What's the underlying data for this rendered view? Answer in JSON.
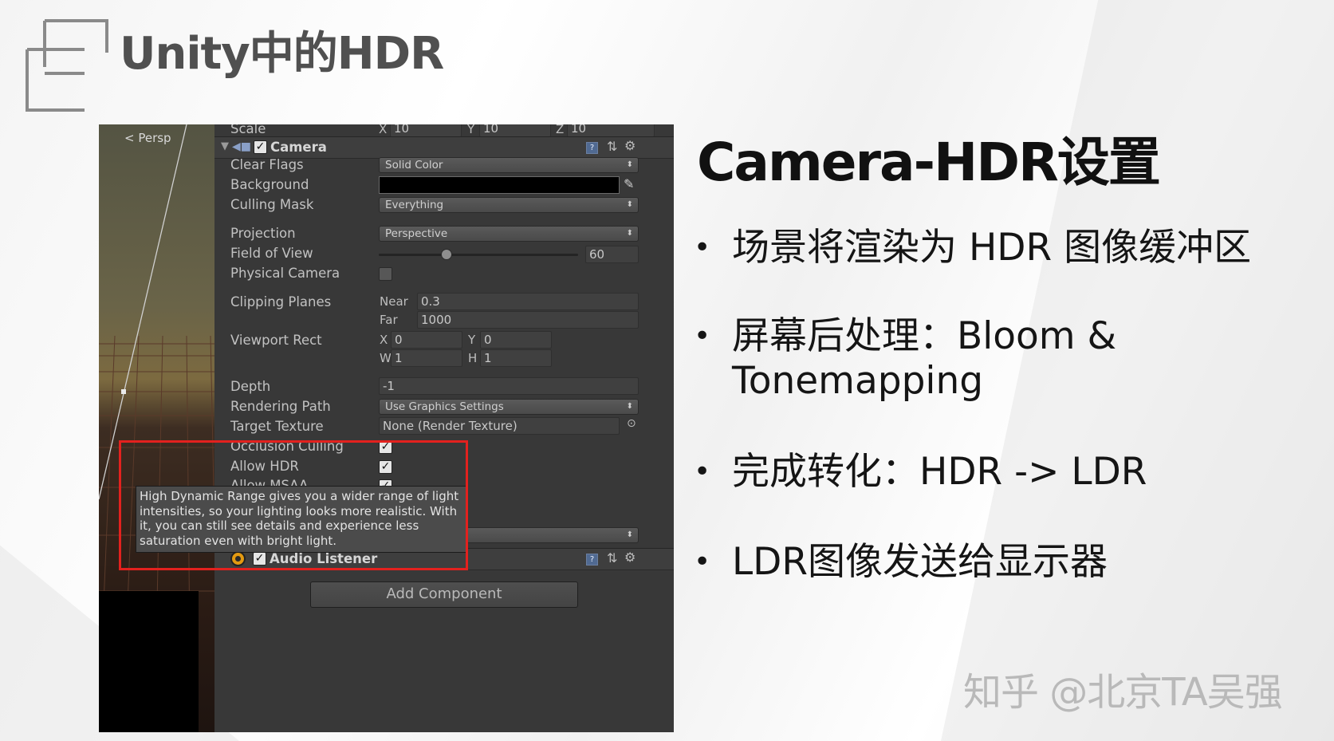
{
  "slide": {
    "title": "Unity中的HDR",
    "subtitle": "Camera-HDR设置",
    "bullets": [
      "场景将渲染为 HDR 图像缓冲区",
      "屏幕后处理：Bloom & Tonemapping",
      "完成转化：HDR -> LDR",
      "LDR图像发送给显示器"
    ],
    "bullet_symbol": "•",
    "watermark": "知乎 @北京TA吴强"
  },
  "scene_view": {
    "persp_label": "< Persp"
  },
  "inspector": {
    "scale_row": {
      "label": "Scale",
      "x_label": "X",
      "x": "10",
      "y_label": "Y",
      "y": "10",
      "z_label": "Z",
      "z": "10"
    },
    "camera_component": {
      "title": "Camera",
      "enabled": true,
      "fields": {
        "clear_flags": {
          "label": "Clear Flags",
          "value": "Solid Color"
        },
        "background": {
          "label": "Background",
          "color": "#000000"
        },
        "culling_mask": {
          "label": "Culling Mask",
          "value": "Everything"
        },
        "projection": {
          "label": "Projection",
          "value": "Perspective"
        },
        "field_of_view": {
          "label": "Field of View",
          "value": "60"
        },
        "physical_camera": {
          "label": "Physical Camera",
          "checked": false
        },
        "clipping_planes": {
          "label": "Clipping Planes",
          "near_label": "Near",
          "near": "0.3",
          "far_label": "Far",
          "far": "1000"
        },
        "viewport_rect": {
          "label": "Viewport Rect",
          "x_label": "X",
          "x": "0",
          "y_label": "Y",
          "y": "0",
          "w_label": "W",
          "w": "1",
          "h_label": "H",
          "h": "1"
        },
        "depth": {
          "label": "Depth",
          "value": "-1"
        },
        "rendering_path": {
          "label": "Rendering Path",
          "value": "Use Graphics Settings"
        },
        "target_texture": {
          "label": "Target Texture",
          "value": "None (Render Texture)"
        },
        "occlusion_culling": {
          "label": "Occlusion Culling",
          "checked": true
        },
        "allow_hdr": {
          "label": "Allow HDR",
          "checked": true
        },
        "allow_msaa": {
          "label": "Allow MSAA",
          "checked": true
        }
      }
    },
    "tooltip": "High Dynamic Range gives you a wider range of light intensities, so your lighting looks more realistic. With it, you can still see details and experience less saturation even with bright light.",
    "audio_listener": {
      "title": "Audio Listener",
      "enabled": true
    },
    "add_component_label": "Add Component",
    "check_glyph": "✓",
    "dropdown_arrow": "⬍",
    "help_icon_glyph": "?",
    "layout_icon_glyph": "⇅",
    "gear_icon_glyph": "⚙",
    "picker_icon_glyph": "⊙",
    "eyedropper_glyph": "✎"
  },
  "colors": {
    "highlight_box": "#e3211e",
    "title_gray": "#505050",
    "watermark_gray": "#b9b9b9"
  }
}
